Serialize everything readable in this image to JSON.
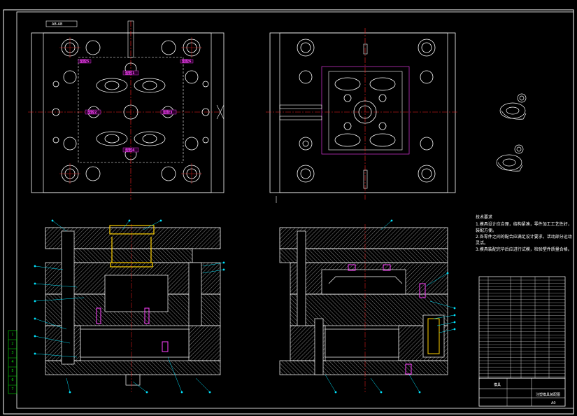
{
  "drawing": {
    "view_label": "AB-AB",
    "tech_notes_title": "技术要求",
    "tech_notes": [
      "1.模具设计应合理，结构紧凑，零件加工工艺性好，装配方便。",
      "2.各零件之间的配合应满足设计要求，活动部分运动灵活。",
      "3.模具装配完毕后应进行试模，检验塑件质量合格。"
    ],
    "cavity_tags": [
      "型腔1",
      "型腔2",
      "型腔3",
      "型腔4",
      "型腔5",
      "型腔6"
    ],
    "side_table_entries": [
      "1",
      "2",
      "3",
      "4",
      "5",
      "6",
      "7"
    ],
    "title_block_name": "模具",
    "title_block_sub": "注塑模具装配图",
    "title_block_scale": "A0",
    "colors": {
      "outline": "#ffffff",
      "centerline": "#ff2020",
      "hatch": "#d0d0d0",
      "leader": "#00e5ff",
      "highlight": "#ffff40",
      "magenta": "#ff40ff",
      "yellow": "#ffd000"
    }
  }
}
